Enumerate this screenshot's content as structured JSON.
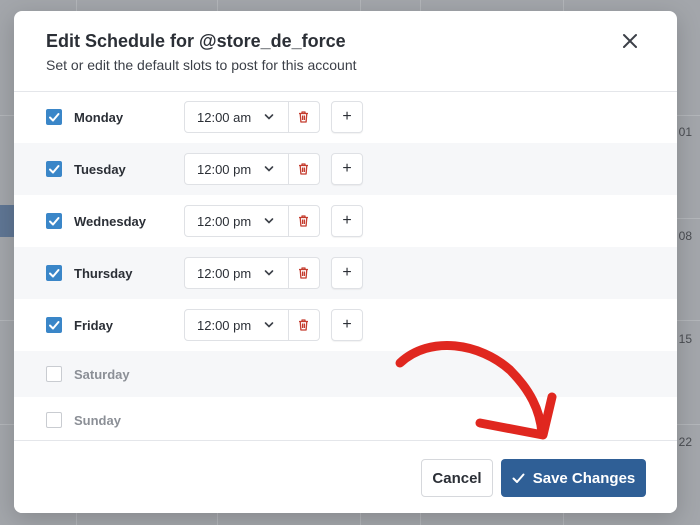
{
  "background_calendar": {
    "day_numbers": [
      "01",
      "08",
      "15",
      "22"
    ]
  },
  "modal": {
    "title": "Edit Schedule for @store_de_force",
    "subtitle": "Set or edit the default slots to post for this account",
    "close_icon": "close-icon"
  },
  "days": [
    {
      "label": "Monday",
      "checked": true,
      "time": "12:00 am"
    },
    {
      "label": "Tuesday",
      "checked": true,
      "time": "12:00 pm"
    },
    {
      "label": "Wednesday",
      "checked": true,
      "time": "12:00 pm"
    },
    {
      "label": "Thursday",
      "checked": true,
      "time": "12:00 pm"
    },
    {
      "label": "Friday",
      "checked": true,
      "time": "12:00 pm"
    },
    {
      "label": "Saturday",
      "checked": false
    },
    {
      "label": "Sunday",
      "checked": false
    }
  ],
  "slot_controls": {
    "add_label": "+",
    "delete_icon": "trash-icon",
    "dropdown_icon": "chevron-down-icon"
  },
  "footer": {
    "cancel_label": "Cancel",
    "save_label": "Save Changes",
    "save_icon": "check-icon"
  },
  "colors": {
    "checkbox_checked": "#3a86c8",
    "save_button": "#2f5f96",
    "delete_icon": "#c43b2d",
    "annotation_arrow": "#e0271f"
  }
}
